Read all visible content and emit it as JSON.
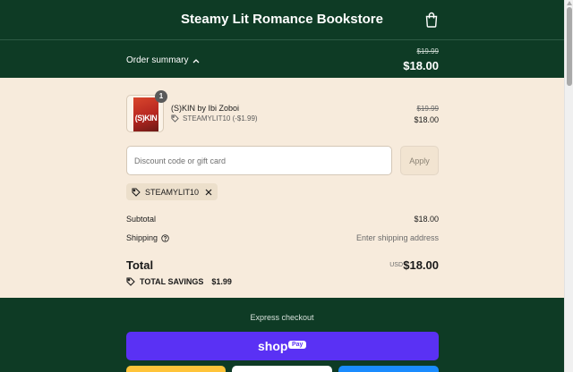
{
  "header": {
    "store_title": "Steamy Lit Romance Bookstore",
    "cart_icon": "shopping-bag-icon"
  },
  "summary_bar": {
    "toggle_label": "Order summary",
    "original_total": "$19.99",
    "total": "$18.00"
  },
  "line_item": {
    "quantity": "1",
    "cover_text": "(S)KIN",
    "title": "(S)KIN by Ibi Zoboi",
    "discount": "STEAMYLIT10 (-$1.99)",
    "original_price": "$19.99",
    "price": "$18.00"
  },
  "discount_form": {
    "placeholder": "Discount code or gift card",
    "apply_label": "Apply"
  },
  "applied_code": {
    "code": "STEAMYLIT10"
  },
  "totals": {
    "subtotal_label": "Subtotal",
    "subtotal_value": "$18.00",
    "shipping_label": "Shipping",
    "shipping_value": "Enter shipping address",
    "total_label": "Total",
    "currency": "USD",
    "total_value": "$18.00",
    "savings_label": "TOTAL SAVINGS",
    "savings_value": "$1.99"
  },
  "express": {
    "label": "Express checkout",
    "shop_word": "shop",
    "shop_pill": "Pay"
  },
  "colors": {
    "brand_dark_green": "#0e3b25",
    "page_background": "#f7ebdc",
    "shop_pay_purple": "#5a31f4"
  }
}
